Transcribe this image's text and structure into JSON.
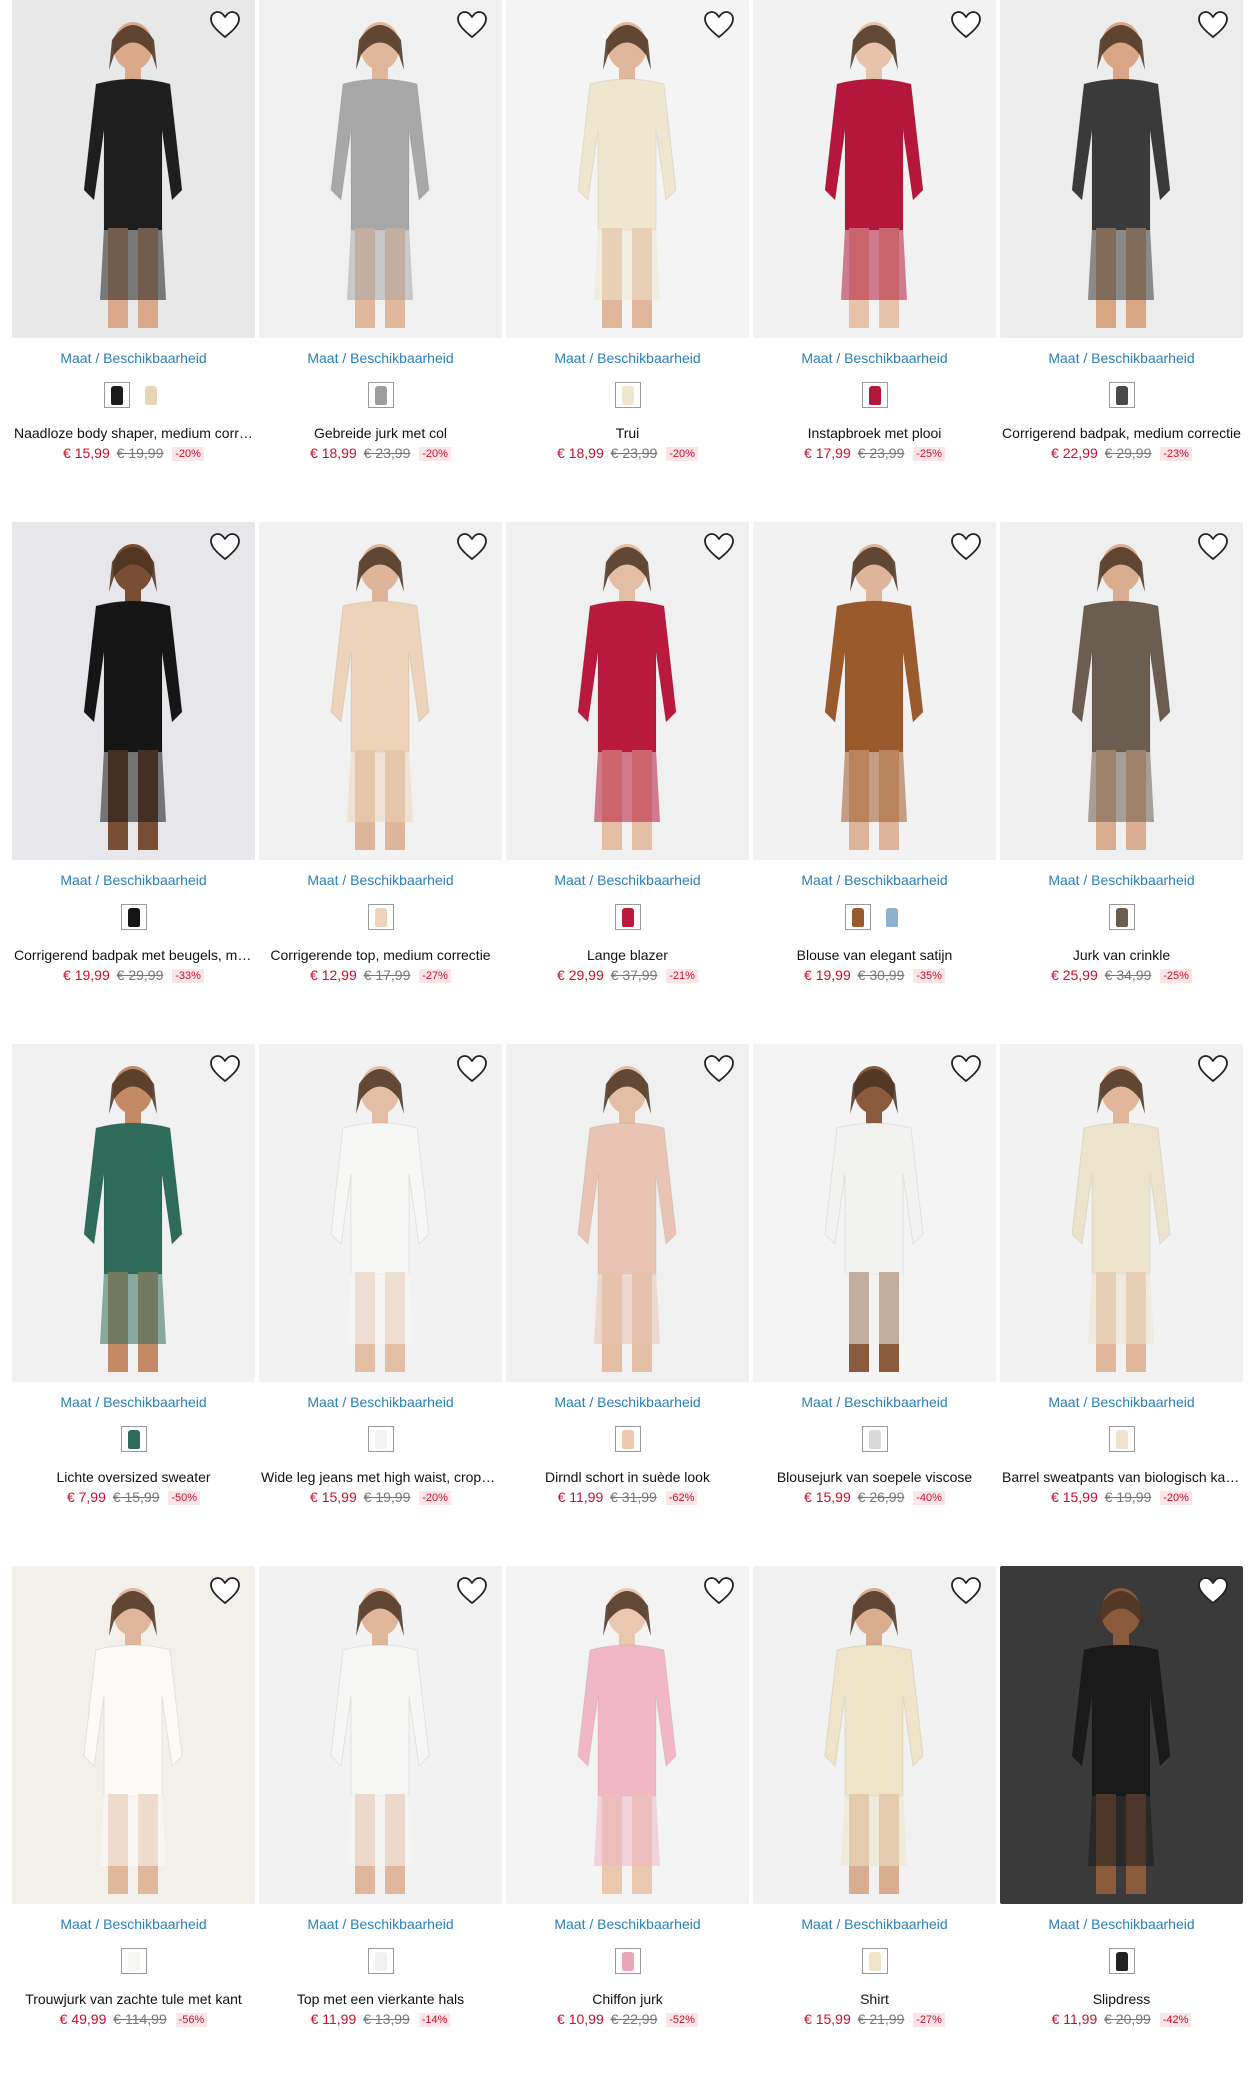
{
  "availability": {
    "maat": "Maat",
    "separator": "/",
    "beschikbaarheid": "Beschikbaarheid"
  },
  "products": [
    {
      "name": "Naadloze body shaper, medium correctie",
      "price": "€ 15,99",
      "old": "€ 19,99",
      "disc": "-20%",
      "bg": "#e8e8e8",
      "garment": "#1e1e1e",
      "skin": "#d9a98a",
      "swatches": [
        "#1c1c1c",
        "#e6d6b8"
      ]
    },
    {
      "name": "Gebreide jurk met col",
      "price": "€ 18,99",
      "old": "€ 23,99",
      "disc": "-20%",
      "bg": "#f0f0f0",
      "garment": "#a8a8a8",
      "skin": "#e0b79a",
      "swatches": [
        "#9d9d9d"
      ]
    },
    {
      "name": "Trui",
      "price": "€ 18,99",
      "old": "€ 23,99",
      "disc": "-20%",
      "bg": "#f4f4f4",
      "garment": "#efe6d0",
      "skin": "#e0b79a",
      "swatches": [
        "#efe6d0"
      ]
    },
    {
      "name": "Instapbroek met plooi",
      "price": "€ 17,99",
      "old": "€ 23,99",
      "disc": "-25%",
      "bg": "#f2f2f2",
      "garment": "#b5173b",
      "skin": "#e6c3aa",
      "swatches": [
        "#b5173b"
      ]
    },
    {
      "name": "Corrigerend badpak, medium correctie",
      "price": "€ 22,99",
      "old": "€ 29,99",
      "disc": "-23%",
      "bg": "#ececec",
      "garment": "#3a3a3a",
      "skin": "#d8a684",
      "swatches": [
        "#4a4a4a"
      ]
    },
    {
      "name": "Corrigerend badpak met beugels, medium correctie",
      "price": "€ 19,99",
      "old": "€ 29,99",
      "disc": "-33%",
      "bg": "#e7e6ea",
      "garment": "#151515",
      "skin": "#7a4e34",
      "swatches": [
        "#151515"
      ]
    },
    {
      "name": "Corrigerende top, medium correctie",
      "price": "€ 12,99",
      "old": "€ 17,99",
      "disc": "-27%",
      "bg": "#f1f1f1",
      "garment": "#ecd3b9",
      "skin": "#deb59a",
      "swatches": [
        "#ecd3b9"
      ]
    },
    {
      "name": "Lange blazer",
      "price": "€ 29,99",
      "old": "€ 37,99",
      "disc": "-21%",
      "bg": "#f0f0f0",
      "garment": "#b8193c",
      "skin": "#e3bea4",
      "swatches": [
        "#b8193c"
      ]
    },
    {
      "name": "Blouse van elegant satijn",
      "price": "€ 19,99",
      "old": "€ 30,99",
      "disc": "-35%",
      "bg": "#f2f2f2",
      "garment": "#9b5a2c",
      "skin": "#deb59a",
      "swatches": [
        "#9b5a2c",
        "#8fb0cf"
      ]
    },
    {
      "name": "Jurk van crinkle",
      "price": "€ 25,99",
      "old": "€ 34,99",
      "disc": "-25%",
      "bg": "#efefef",
      "garment": "#6b5d4f",
      "skin": "#d9ad8f",
      "swatches": [
        "#6b5d4f"
      ]
    },
    {
      "name": "Lichte oversized sweater",
      "price": "€ 7,99",
      "old": "€ 15,99",
      "disc": "-50%",
      "bg": "#f1f1f1",
      "garment": "#2f6b5a",
      "skin": "#c48a66",
      "swatches": [
        "#2f6b5a"
      ]
    },
    {
      "name": "Wide leg jeans met high waist, cropped",
      "price": "€ 15,99",
      "old": "€ 19,99",
      "disc": "-20%",
      "bg": "#f2f2f2",
      "garment": "#f7f7f5",
      "skin": "#e3bea4",
      "swatches": [
        "#f4f4f2"
      ]
    },
    {
      "name": "Dirndl schort in suède look",
      "price": "€ 11,99",
      "old": "€ 31,99",
      "disc": "-62%",
      "bg": "#f0f0f0",
      "garment": "#e9c4b4",
      "skin": "#e3bea4",
      "swatches": [
        "#f0c8b0"
      ]
    },
    {
      "name": "Blousejurk van soepele viscose",
      "price": "€ 15,99",
      "old": "€ 26,99",
      "disc": "-40%",
      "bg": "#f4f4f4",
      "garment": "#f2f2f0",
      "skin": "#8a5a3c",
      "swatches": [
        "#d8d8d8"
      ]
    },
    {
      "name": "Barrel sweatpants van biologisch katoen",
      "price": "€ 15,99",
      "old": "€ 19,99",
      "disc": "-20%",
      "bg": "#f2f2f2",
      "garment": "#ece3cc",
      "skin": "#e0b79a",
      "swatches": [
        "#ece3cc"
      ]
    },
    {
      "name": "Trouwjurk van zachte tule met kant",
      "price": "€ 49,99",
      "old": "€ 114,99",
      "disc": "-56%",
      "bg": "#f3efea",
      "garment": "#fbfaf7",
      "skin": "#e0b79a",
      "swatches": [
        "#f7f6f2"
      ]
    },
    {
      "name": "Top met een vierkante hals",
      "price": "€ 11,99",
      "old": "€ 13,99",
      "disc": "-14%",
      "bg": "#f2f2f2",
      "garment": "#f6f6f4",
      "skin": "#e0b79a",
      "swatches": [
        "#f1f1f0"
      ]
    },
    {
      "name": "Chiffon jurk",
      "price": "€ 10,99",
      "old": "€ 22,99",
      "disc": "-52%",
      "bg": "#f3f3f3",
      "garment": "#f1b7c7",
      "skin": "#eac8b0",
      "swatches": [
        "#e8a6b8"
      ]
    },
    {
      "name": "Shirt",
      "price": "€ 15,99",
      "old": "€ 21,99",
      "disc": "-27%",
      "bg": "#f1f1f1",
      "garment": "#efe3c8",
      "skin": "#d9ad8f",
      "swatches": [
        "#efe3c8"
      ]
    },
    {
      "name": "Slipdress",
      "price": "€ 11,99",
      "old": "€ 20,99",
      "disc": "-42%",
      "bg": "#3a3a3a",
      "garment": "#1a1a1a",
      "skin": "#8a5a3c",
      "swatches": [
        "#222222"
      ]
    }
  ]
}
